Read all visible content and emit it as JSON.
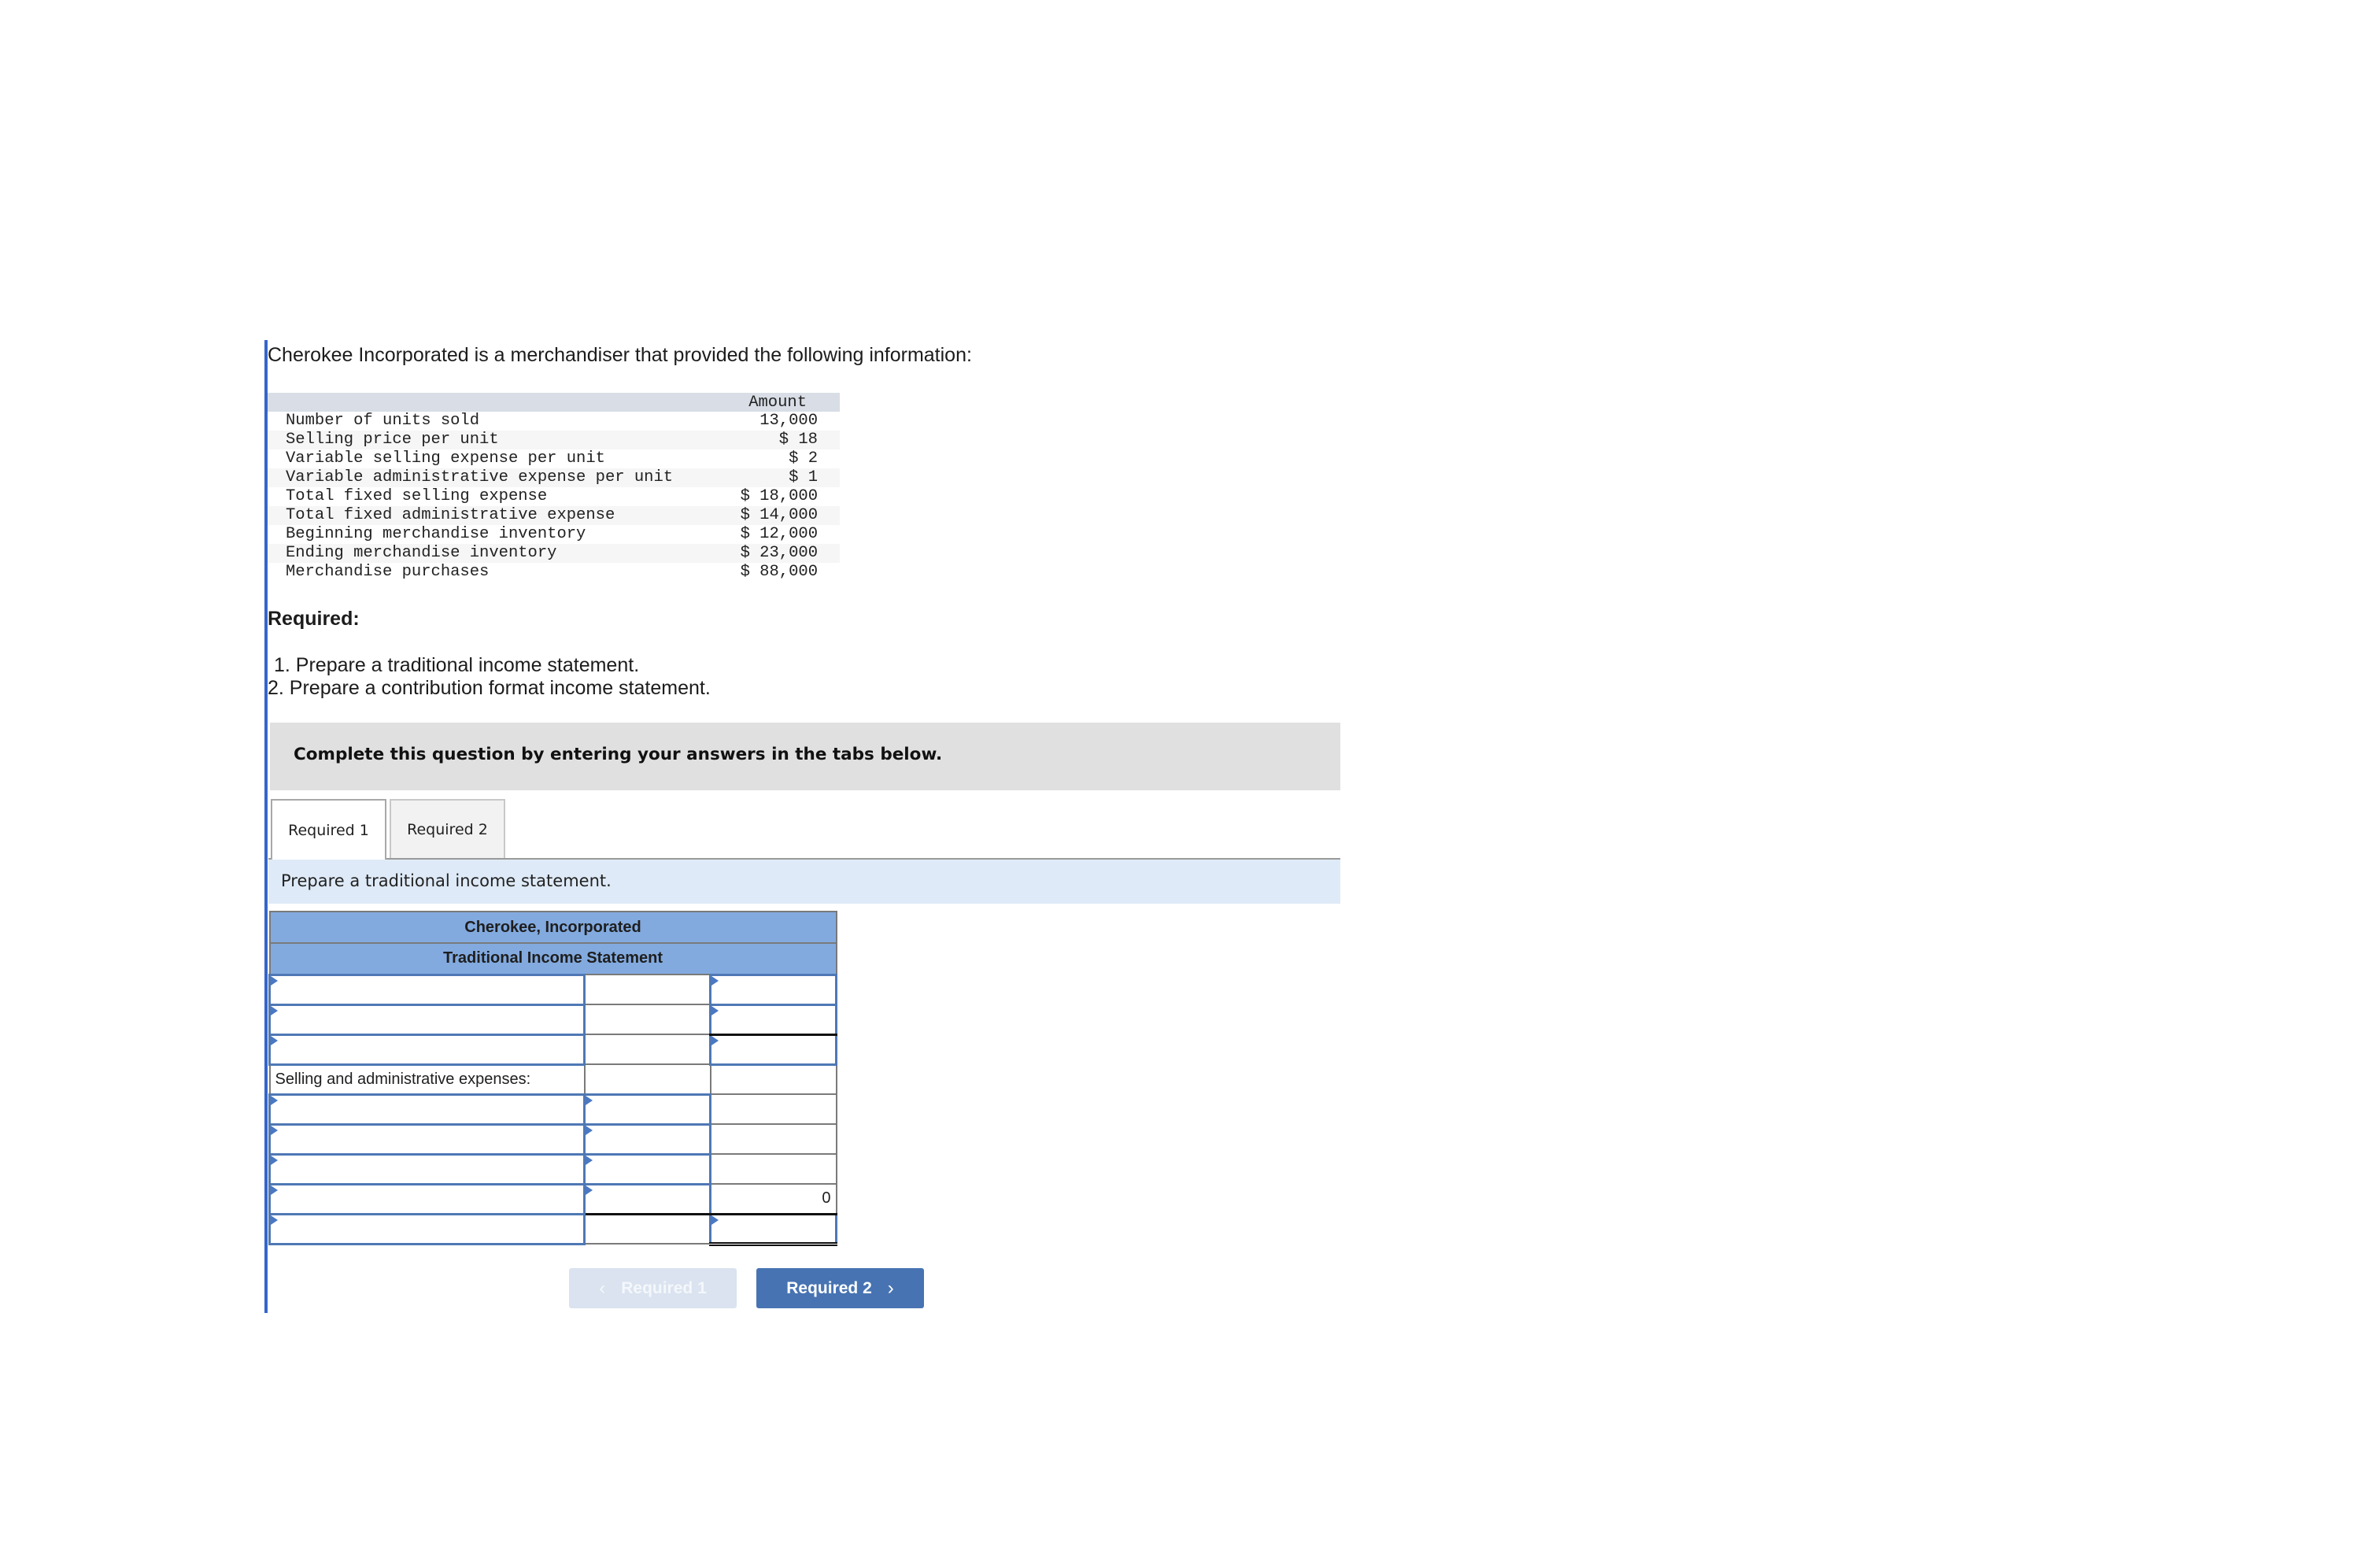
{
  "problem": {
    "intro": "Cherokee Incorporated is a merchandiser that provided the following information:",
    "given_table": {
      "header": "Amount",
      "rows": [
        {
          "label": "Number of units sold",
          "value": "13,000"
        },
        {
          "label": "Selling price per unit",
          "value": "$ 18"
        },
        {
          "label": "Variable selling expense per unit",
          "value": "$ 2"
        },
        {
          "label": "Variable administrative expense per unit",
          "value": "$ 1"
        },
        {
          "label": "Total fixed selling expense",
          "value": "$ 18,000"
        },
        {
          "label": "Total fixed administrative expense",
          "value": "$ 14,000"
        },
        {
          "label": "Beginning merchandise inventory",
          "value": "$ 12,000"
        },
        {
          "label": "Ending merchandise inventory",
          "value": "$ 23,000"
        },
        {
          "label": "Merchandise purchases",
          "value": "$ 88,000"
        }
      ]
    },
    "required_heading": "Required:",
    "required_items": [
      "1. Prepare a traditional income statement.",
      "2. Prepare a contribution format income statement."
    ]
  },
  "banner": "Complete this question by entering your answers in the tabs below.",
  "tabs": [
    {
      "label": "Required 1",
      "active": true
    },
    {
      "label": "Required 2",
      "active": false
    }
  ],
  "instruction": "Prepare a traditional income statement.",
  "statement": {
    "company": "Cherokee, Incorporated",
    "title": "Traditional Income Statement",
    "section_label": "Selling and administrative expenses:",
    "subtotal_value": "0"
  },
  "nav": {
    "prev_label": "Required 1",
    "next_label": "Required 2"
  }
}
